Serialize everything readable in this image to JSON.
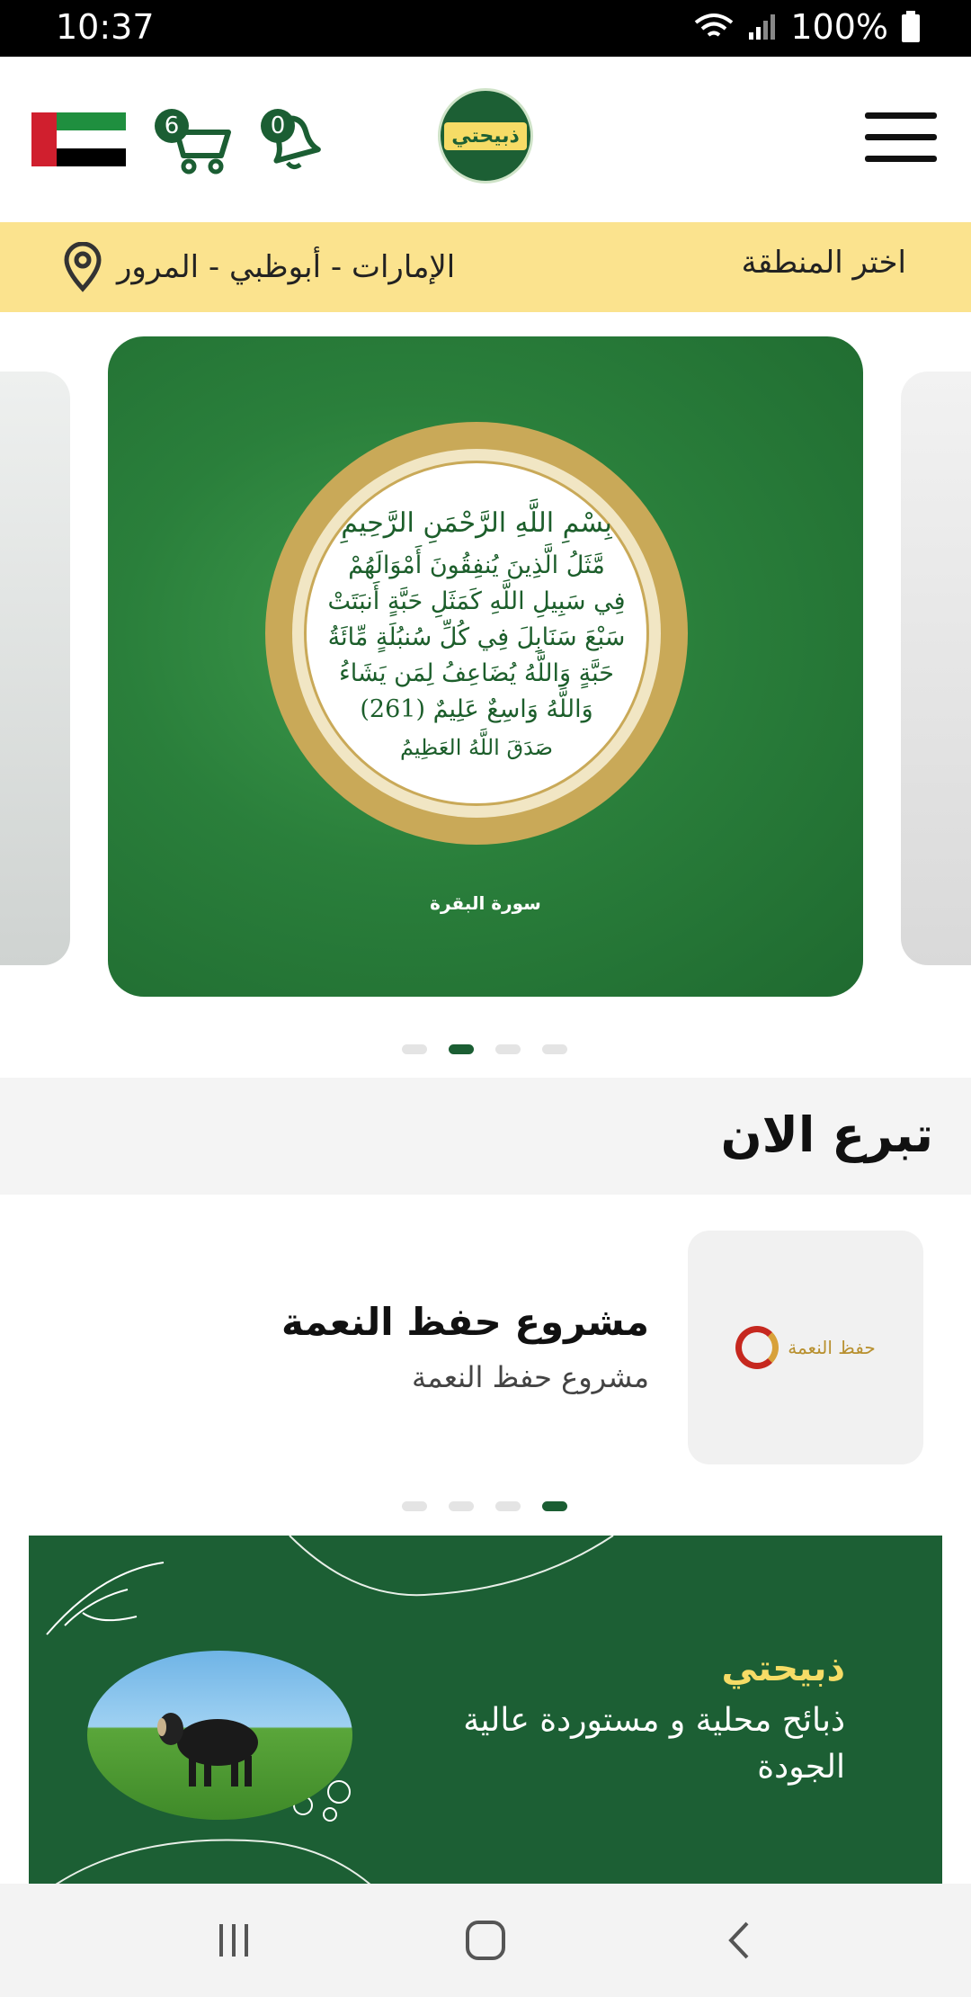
{
  "status_bar": {
    "time": "10:37",
    "battery": "100%"
  },
  "header": {
    "cart_count": "6",
    "notification_count": "0",
    "logo_text": "ذبيحتي"
  },
  "region": {
    "choose_label": "اختر المنطقة",
    "location": "الإمارات - أبوظبي - المرور"
  },
  "carousel": {
    "basmala": "بِسْمِ اللَّهِ الرَّحْمَنِ الرَّحِيمِ",
    "verse_lines": [
      "مَّثَلُ الَّذِينَ يُنفِقُونَ أَمْوَالَهُمْ",
      "فِي سَبِيلِ اللَّهِ كَمَثَلِ حَبَّةٍ أَنبَتَتْ",
      "سَبْعَ سَنَابِلَ فِي كُلِّ سُنبُلَةٍ مِّائَةُ",
      "حَبَّةٍ وَاللَّهُ يُضَاعِفُ لِمَن يَشَاءُ",
      "وَاللَّهُ وَاسِعٌ عَلِيمٌ (261)"
    ],
    "closing": "صَدَقَ اللَّهُ العَظِيمُ",
    "surah": "سورة البقرة",
    "active_index": 1,
    "slide_count": 4
  },
  "donate": {
    "heading": "تبرع الان",
    "card_title": "مشروع حفظ النعمة",
    "card_subtitle": "مشروع حفظ النعمة",
    "card_logo_text": "حفظ النعمة",
    "active_index": 3,
    "slide_count": 4
  },
  "banner": {
    "brand": "ذبيحتي",
    "tagline": "ذبائح محلية و مستوردة عالية الجودة"
  },
  "colors": {
    "primary_green": "#1b5e33",
    "region_yellow": "#fbe38e",
    "brand_yellow": "#f6dc66"
  }
}
